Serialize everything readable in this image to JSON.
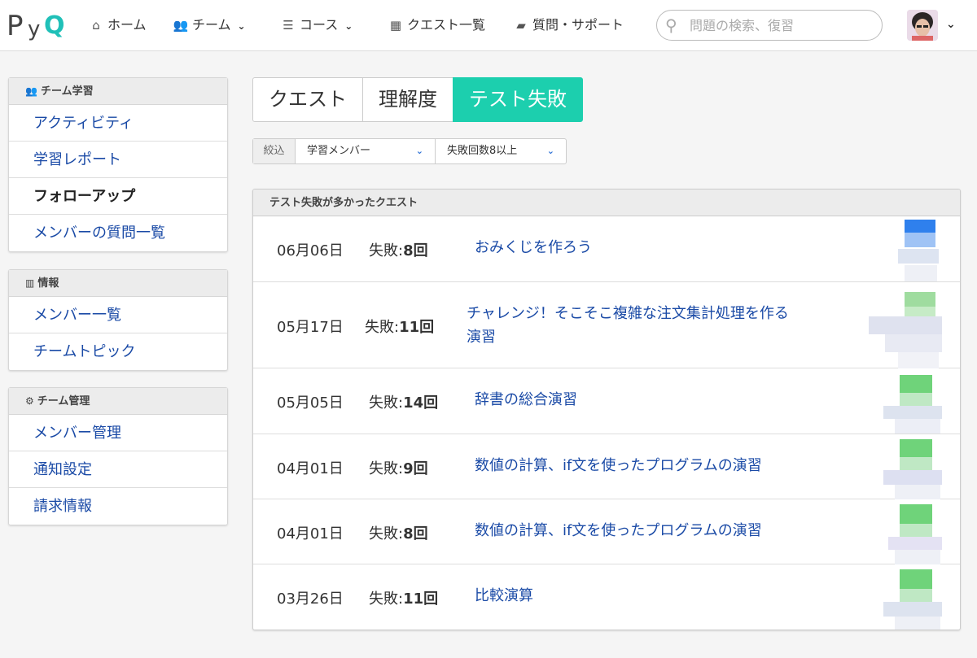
{
  "nav": {
    "logo_p": "P",
    "logo_y": "y",
    "logo_q": "Q",
    "items": [
      {
        "label": "ホーム",
        "icon": "home-icon"
      },
      {
        "label": "チーム",
        "icon": "team-icon"
      },
      {
        "label": "コース",
        "icon": "list-icon"
      },
      {
        "label": "クエスト一覧",
        "icon": "grid-icon"
      },
      {
        "label": "質問・サポート",
        "icon": "chat-icon"
      }
    ],
    "search_placeholder": "問題の検索、復習"
  },
  "sidebar": {
    "team_learning": {
      "heading": "チーム学習",
      "items": [
        "アクティビティ",
        "学習レポート",
        "フォローアップ",
        "メンバーの質問一覧"
      ]
    },
    "info": {
      "heading": "情報",
      "items": [
        "メンバー一覧",
        "チームトピック"
      ]
    },
    "team_admin": {
      "heading": "チーム管理",
      "items": [
        "メンバー管理",
        "通知設定",
        "請求情報"
      ]
    }
  },
  "tabs": [
    "クエスト",
    "理解度",
    "テスト失敗"
  ],
  "filter": {
    "label": "絞込",
    "member": "学習メンバー",
    "count": "失敗回数8以上"
  },
  "panel": {
    "heading": "テスト失敗が多かったクエスト",
    "fail_prefix": "失敗:",
    "rows": [
      {
        "date": "06月06日",
        "count": "8回",
        "title": "おみくじを作ろう"
      },
      {
        "date": "05月17日",
        "count": "11回",
        "title_line1": "チャレンジ！そこそこ複雑な注文集計処理を作る",
        "title_line2": "演習"
      },
      {
        "date": "05月05日",
        "count": "14回",
        "title": "辞書の総合演習"
      },
      {
        "date": "04月01日",
        "count": "9回",
        "title": "数値の計算、if文を使ったプログラムの演習"
      },
      {
        "date": "04月01日",
        "count": "8回",
        "title": "数値の計算、if文を使ったプログラムの演習"
      },
      {
        "date": "03月26日",
        "count": "11回",
        "title": "比較演算"
      }
    ]
  },
  "colors": {
    "accent": "#1ccfae",
    "link": "#1a4aa6",
    "logo_q": "#20c0b8"
  }
}
